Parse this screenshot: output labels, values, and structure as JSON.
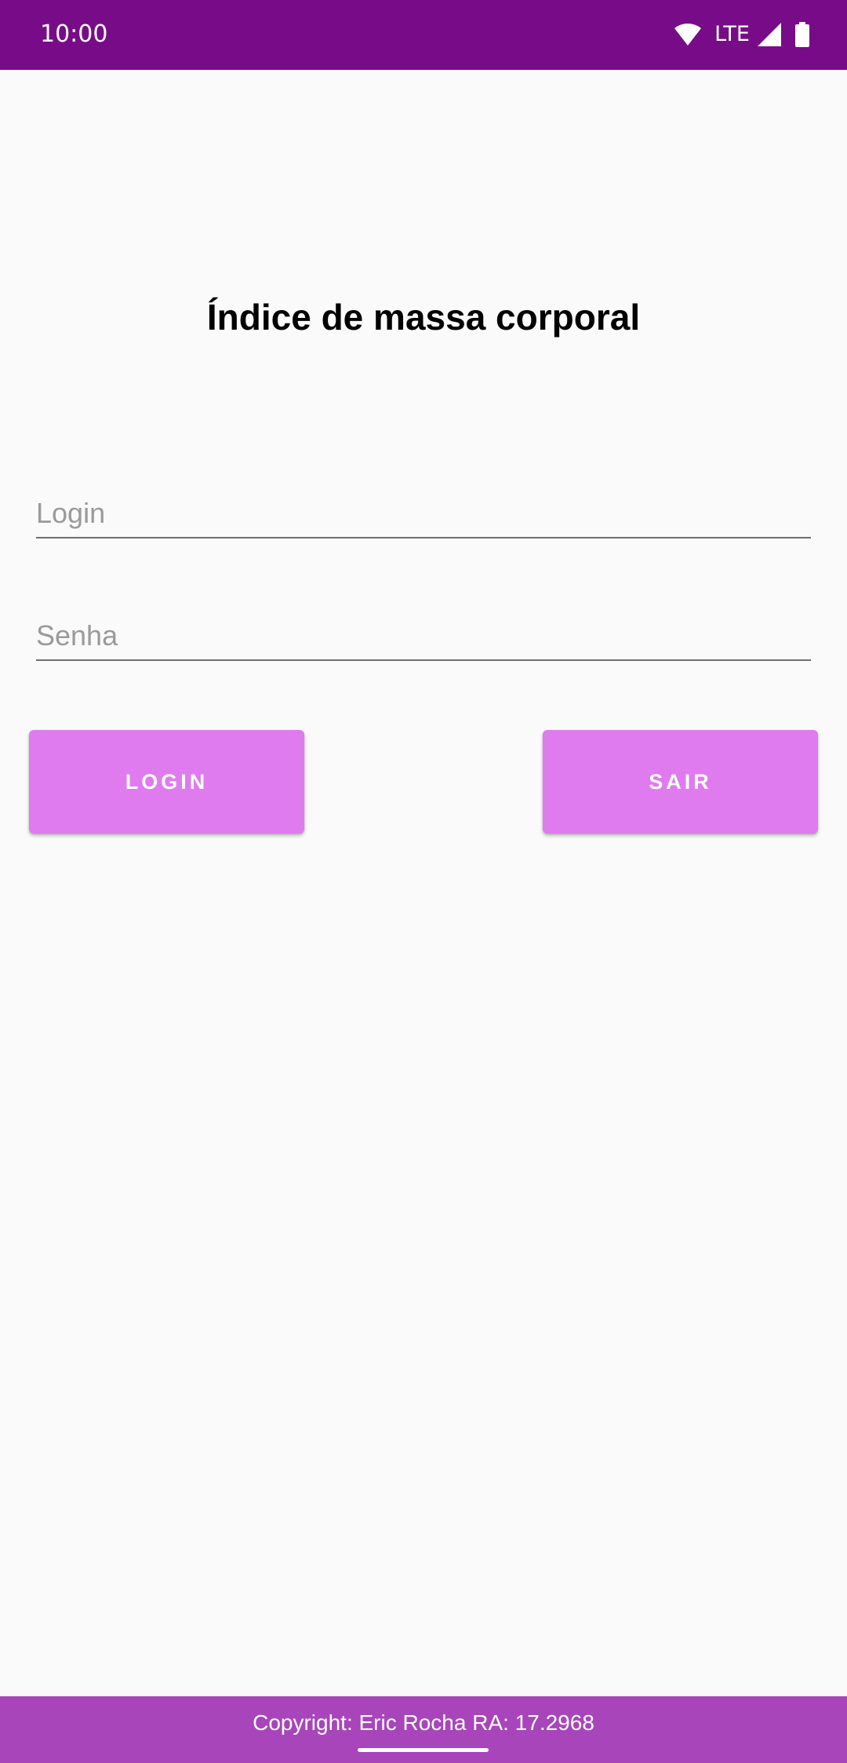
{
  "status_bar": {
    "time": "10:00",
    "network": "LTE",
    "icons": [
      "wifi-icon",
      "cellular-signal-icon",
      "battery-icon"
    ]
  },
  "title": "Índice de massa corporal",
  "form": {
    "login_placeholder": "Login",
    "login_value": "",
    "password_placeholder": "Senha",
    "password_value": ""
  },
  "buttons": {
    "login_label": "LOGIN",
    "exit_label": "SAIR"
  },
  "footer": {
    "copyright": "Copyright: Eric Rocha RA: 17.2968"
  },
  "colors": {
    "status_bar": "#780c88",
    "button": "#df7bef",
    "footer": "#a845bb",
    "background": "#fafafa"
  }
}
